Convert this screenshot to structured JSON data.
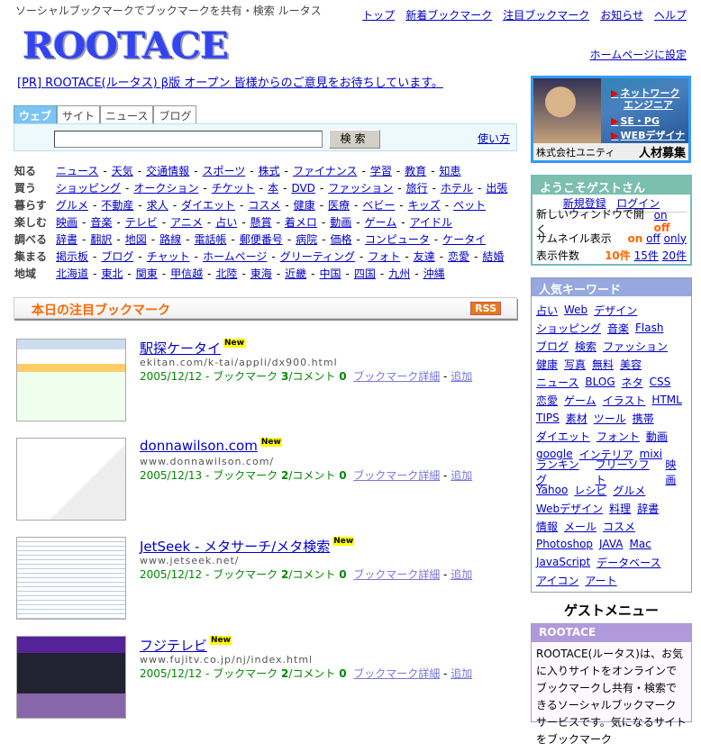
{
  "header": {
    "tagline": "ソーシャルブックマークでブックマークを共有・検索 ルータス",
    "logo": "ROOTACE",
    "nav": [
      "トップ",
      "新着ブックマーク",
      "注目ブックマーク",
      "お知らせ",
      "ヘルプ"
    ],
    "homepage_link": "ホームページに設定"
  },
  "pr": "[PR] ROOTACE(ルータス) β版 オープン 皆様からのご意見をお待ちしています。",
  "search": {
    "tabs": [
      "ウェブ",
      "サイト",
      "ニュース",
      "ブログ"
    ],
    "active_tab": 0,
    "value": "",
    "button": "検索",
    "help": "使い方"
  },
  "categories": [
    {
      "label": "知る",
      "links": [
        "ニュース",
        "天気",
        "交通情報",
        "スポーツ",
        "株式",
        "ファイナンス",
        "学習",
        "教育",
        "知恵"
      ]
    },
    {
      "label": "買う",
      "links": [
        "ショッピング",
        "オークション",
        "チケット",
        "本",
        "DVD",
        "ファッション",
        "旅行",
        "ホテル",
        "出張"
      ]
    },
    {
      "label": "暮らす",
      "links": [
        "グルメ",
        "不動産",
        "求人",
        "ダイエット",
        "コスメ",
        "健康",
        "医療",
        "ベビー",
        "キッズ",
        "ペット"
      ]
    },
    {
      "label": "楽しむ",
      "links": [
        "映画",
        "音楽",
        "テレビ",
        "アニメ",
        "占い",
        "懸賞",
        "着メロ",
        "動画",
        "ゲーム",
        "アイドル"
      ]
    },
    {
      "label": "調べる",
      "links": [
        "辞書",
        "翻訳",
        "地図",
        "路線",
        "電話帳",
        "郵便番号",
        "病院",
        "価格",
        "コンピュータ",
        "ケータイ"
      ]
    },
    {
      "label": "集まる",
      "links": [
        "掲示板",
        "ブログ",
        "チャット",
        "ホームページ",
        "グリーティング",
        "フォト",
        "友達",
        "恋愛",
        "結婚"
      ]
    },
    {
      "label": "地域",
      "links": [
        "北海道",
        "東北",
        "関東",
        "甲信越",
        "北陸",
        "東海",
        "近畿",
        "中国",
        "四国",
        "九州",
        "沖縄"
      ]
    }
  ],
  "bookmarks": {
    "title": "本日の注目ブックマーク",
    "rss": "RSS",
    "badge": "New",
    "bm_label": "ブックマーク",
    "comment_label": "/コメント",
    "detail": "ブックマーク詳細",
    "add": "追加",
    "items": [
      {
        "title": "駅探ケータイ",
        "url": "ekitan.com/k-tai/appli/dx900.html",
        "date": "2005/12/12",
        "bookmarks": "3",
        "comments": "0"
      },
      {
        "title": "donnawilson.com",
        "url": "www.donnawilson.com/",
        "date": "2005/12/13",
        "bookmarks": "2",
        "comments": "0"
      },
      {
        "title": "JetSeek - メタサーチ/メタ検索",
        "url": "www.jetseek.net/",
        "date": "2005/12/12",
        "bookmarks": "2",
        "comments": "0"
      },
      {
        "title": "フジテレビ",
        "url": "www.fujitv.co.jp/nj/index.html",
        "date": "2005/12/12",
        "bookmarks": "2",
        "comments": "0"
      }
    ]
  },
  "banner": {
    "links": [
      "ネットワーク",
      "エンジニア",
      "SE・PG",
      "WEBデザイナー"
    ],
    "company": "株式会社ユニティ",
    "recruit": "人材募集"
  },
  "welcome": {
    "title": "ようこそゲストさん",
    "register": "新規登録",
    "login": "ログイン",
    "newwin_label": "新しいウィンドウで開く",
    "newwin": [
      "on",
      "off"
    ],
    "thumb_label": "サムネイル表示",
    "thumb": [
      "on",
      "off",
      "only"
    ],
    "count_label": "表示件数",
    "count": [
      "10件",
      "15件",
      "20件"
    ]
  },
  "keywords": {
    "title": "人気キーワード",
    "rows": [
      [
        "占い",
        "Web",
        "デザイン"
      ],
      [
        "ショッピング",
        "音楽",
        "Flash"
      ],
      [
        "ブログ",
        "検索",
        "ファッション"
      ],
      [
        "健康",
        "写真",
        "無料",
        "美容"
      ],
      [
        "ニュース",
        "BLOG",
        "ネタ",
        "CSS"
      ],
      [
        "恋愛",
        "ゲーム",
        "イラスト",
        "HTML"
      ],
      [
        "TIPS",
        "素材",
        "ツール",
        "携帯"
      ],
      [
        "ダイエット",
        "フォント",
        "動画"
      ],
      [
        "google",
        "インテリア",
        "mixi"
      ],
      [
        "ランキング",
        "フリーソフト",
        "映画"
      ],
      [
        "Yahoo",
        "レシピ",
        "グルメ"
      ],
      [
        "Webデザイン",
        "料理",
        "辞書"
      ],
      [
        "情報",
        "メール",
        "コスメ"
      ],
      [
        "Photoshop",
        "JAVA",
        "Mac"
      ],
      [
        "JavaScript",
        "データベース"
      ],
      [
        "アイコン",
        "アート"
      ]
    ]
  },
  "guest_menu": "ゲストメニュー",
  "about": {
    "title": "ROOTACE",
    "text": "ROOTACE(ルータス)は、お気に入りサイトをオンラインでブックマークし共有・検索できるソーシャルブックマークサービスです。気になるサイトをブックマーク"
  }
}
